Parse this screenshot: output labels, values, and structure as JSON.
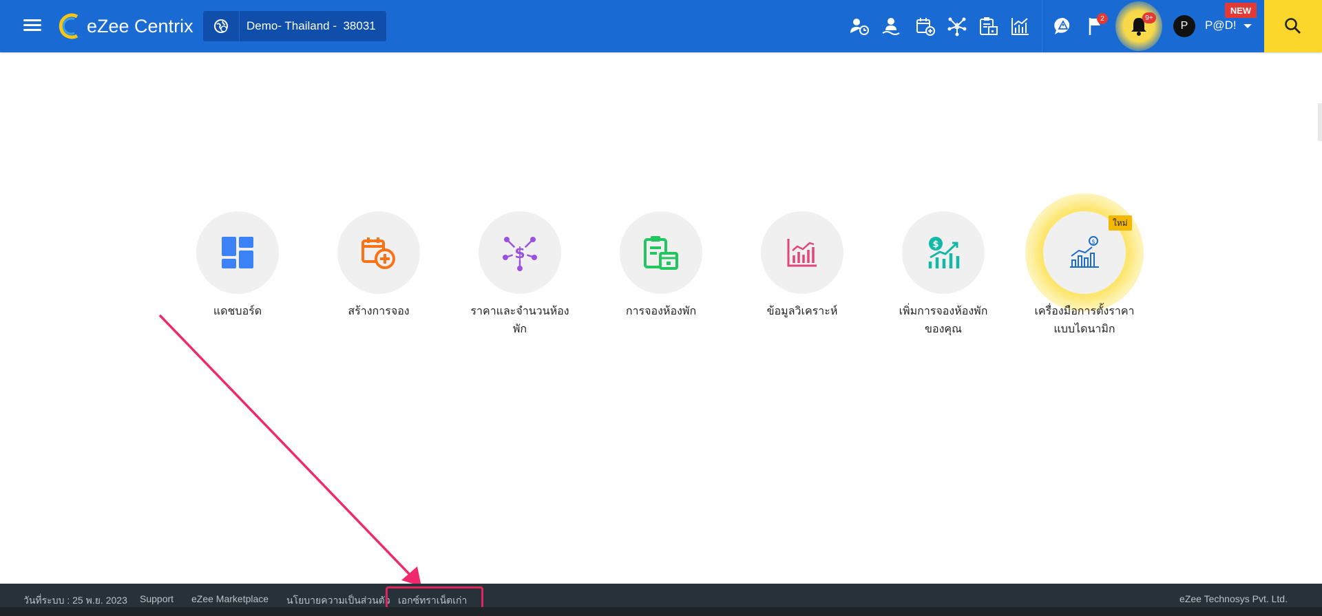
{
  "header": {
    "app_name": "eZee Centrix",
    "property_name": "Demo- Thailand -  38031",
    "flag_badge": "2",
    "bell_badge": "9+",
    "new_label": "NEW",
    "avatar_initial": "P",
    "user_name": "P@D!",
    "icons": [
      "menu-icon",
      "logo-icon",
      "globe-icon",
      "user-clock-icon",
      "guest-icon",
      "calendar-add-icon",
      "rate-network-icon",
      "clipboard-calendar-icon",
      "chart-icon",
      "warning-chat-icon",
      "flag-icon",
      "bell-icon",
      "search-icon"
    ],
    "colors": {
      "primary": "#1a6ad4",
      "search_bg": "#fcd72b",
      "badge": "#e53935"
    }
  },
  "modules": [
    {
      "label": "แดชบอร์ด",
      "icon": "dashboard-icon",
      "color": "#3b82f6"
    },
    {
      "label": "สร้างการจอง",
      "icon": "calendar-add-icon",
      "color": "#f97316"
    },
    {
      "label": "ราคาและจำนวนห้องพัก",
      "icon": "rate-network-icon",
      "color": "#9b51e0"
    },
    {
      "label": "การจองห้องพัก",
      "icon": "clipboard-calendar-icon",
      "color": "#22c55e"
    },
    {
      "label": "ข้อมูลวิเคราะห์",
      "icon": "analytics-icon",
      "color": "#e0457b"
    },
    {
      "label": "เพิ่มการจองห้องพักของคุณ",
      "icon": "boost-revenue-icon",
      "color": "#14b8a6"
    },
    {
      "label": "เครื่องมือการตั้งราคาแบบไดนามิก",
      "icon": "dynamic-pricing-icon",
      "color": "#1a6ad4",
      "tag": "ใหม่"
    }
  ],
  "footer": {
    "system_date": "วันที่ระบบ : 25 พ.ย. 2023",
    "support": "Support",
    "marketplace": "eZee Marketplace",
    "privacy": "นโยบายความเป็นส่วนตัว",
    "legacy_extranet": "เอกซ์ทราเน็ตเก่า",
    "company": "eZee Technosys Pvt. Ltd."
  }
}
